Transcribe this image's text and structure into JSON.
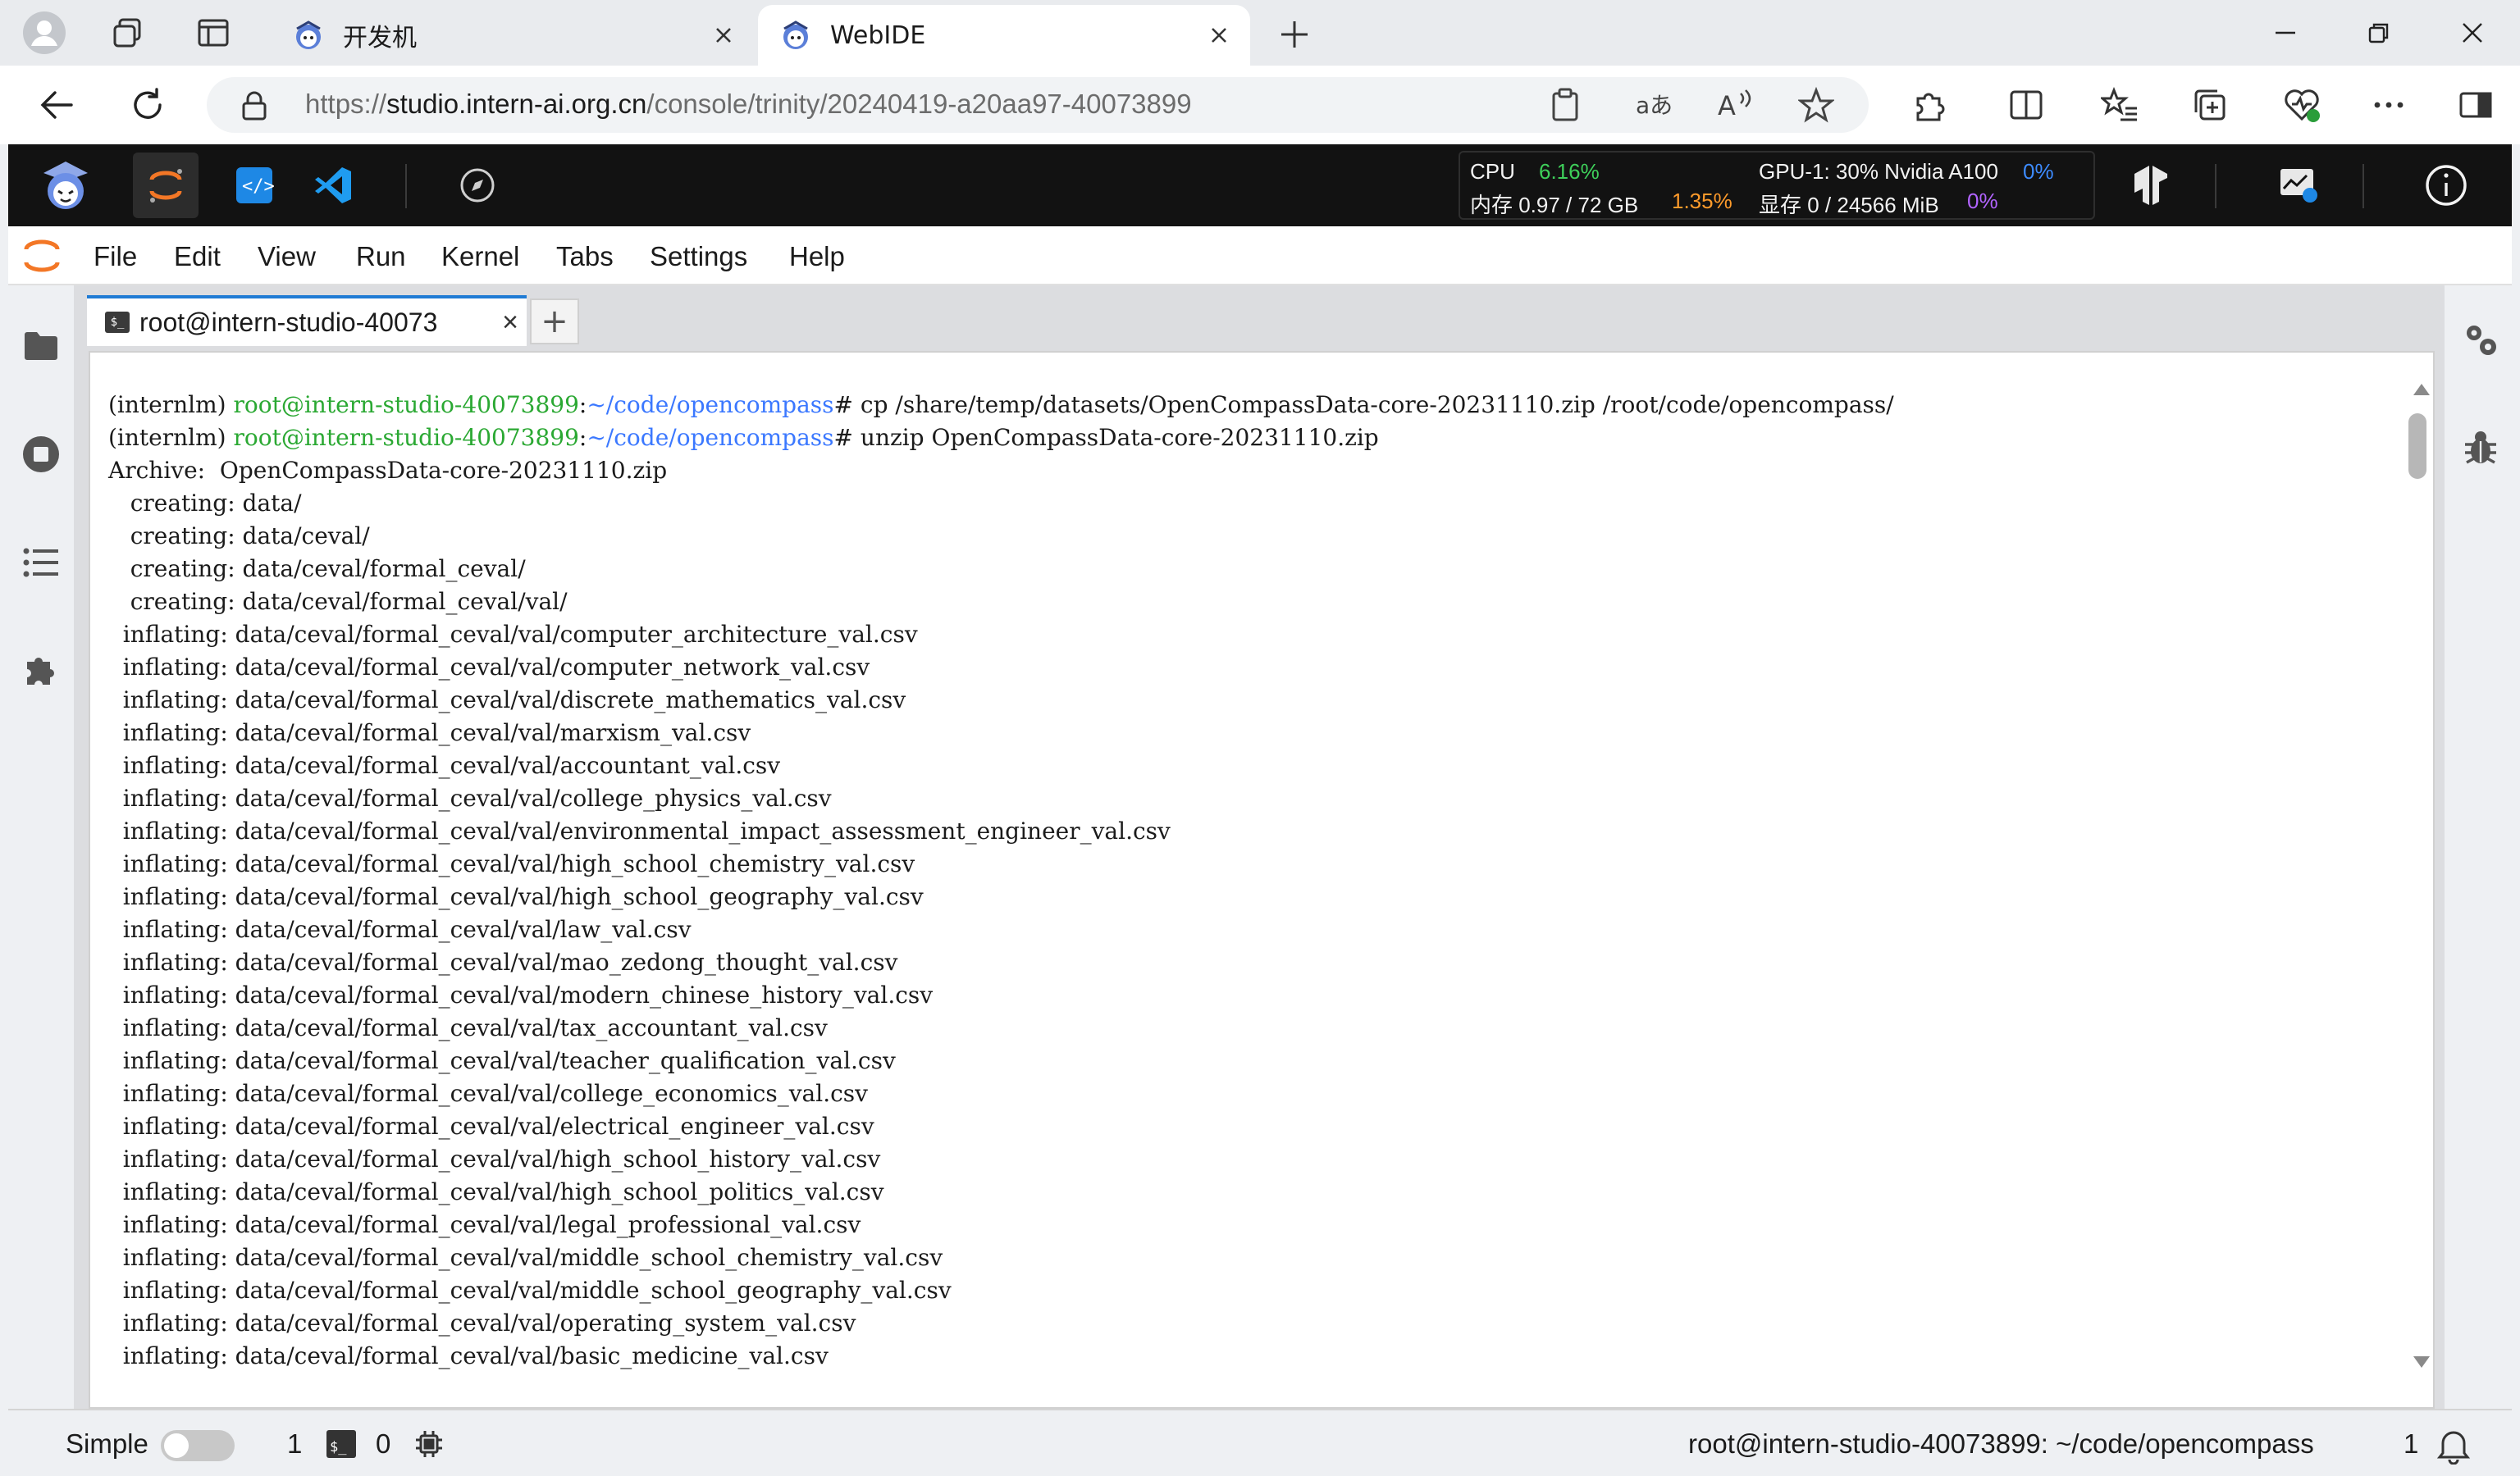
{
  "browser": {
    "tabs": [
      {
        "title": "开发机"
      },
      {
        "title": "WebIDE"
      }
    ],
    "url": {
      "scheme": "https://",
      "host": "studio.intern-ai.org.cn",
      "path": "/console/trinity/20240419-a20aa97-40073899"
    }
  },
  "studio": {
    "monitor": {
      "cpu_label": "CPU",
      "cpu_value": "6.16%",
      "mem_label": "内存 0.97 / 72 GB",
      "mem_value": "1.35%",
      "gpu_label": "GPU-1: 30% Nvidia A100",
      "gpu_value": "0%",
      "vram_label": "显存 0 / 24566 MiB",
      "vram_value": "0%"
    }
  },
  "menu": [
    "File",
    "Edit",
    "View",
    "Run",
    "Kernel",
    "Tabs",
    "Settings",
    "Help"
  ],
  "terminal": {
    "tab_title": "root@intern-studio-40073",
    "tab_icon_text": "$_",
    "prompts": [
      {
        "env": "(internlm) ",
        "user": "root@intern-studio-40073899",
        "sep": ":",
        "path": "~/code/opencompass",
        "cmd": "# cp /share/temp/datasets/OpenCompassData-core-20231110.zip /root/code/opencompass/"
      },
      {
        "env": "(internlm) ",
        "user": "root@intern-studio-40073899",
        "sep": ":",
        "path": "~/code/opencompass",
        "cmd": "# unzip OpenCompassData-core-20231110.zip"
      }
    ],
    "output": [
      "Archive:  OpenCompassData-core-20231110.zip",
      "   creating: data/",
      "   creating: data/ceval/",
      "   creating: data/ceval/formal_ceval/",
      "   creating: data/ceval/formal_ceval/val/",
      "  inflating: data/ceval/formal_ceval/val/computer_architecture_val.csv",
      "  inflating: data/ceval/formal_ceval/val/computer_network_val.csv",
      "  inflating: data/ceval/formal_ceval/val/discrete_mathematics_val.csv",
      "  inflating: data/ceval/formal_ceval/val/marxism_val.csv",
      "  inflating: data/ceval/formal_ceval/val/accountant_val.csv",
      "  inflating: data/ceval/formal_ceval/val/college_physics_val.csv",
      "  inflating: data/ceval/formal_ceval/val/environmental_impact_assessment_engineer_val.csv",
      "  inflating: data/ceval/formal_ceval/val/high_school_chemistry_val.csv",
      "  inflating: data/ceval/formal_ceval/val/high_school_geography_val.csv",
      "  inflating: data/ceval/formal_ceval/val/law_val.csv",
      "  inflating: data/ceval/formal_ceval/val/mao_zedong_thought_val.csv",
      "  inflating: data/ceval/formal_ceval/val/modern_chinese_history_val.csv",
      "  inflating: data/ceval/formal_ceval/val/tax_accountant_val.csv",
      "  inflating: data/ceval/formal_ceval/val/teacher_qualification_val.csv",
      "  inflating: data/ceval/formal_ceval/val/college_economics_val.csv",
      "  inflating: data/ceval/formal_ceval/val/electrical_engineer_val.csv",
      "  inflating: data/ceval/formal_ceval/val/high_school_history_val.csv",
      "  inflating: data/ceval/formal_ceval/val/high_school_politics_val.csv",
      "  inflating: data/ceval/formal_ceval/val/legal_professional_val.csv",
      "  inflating: data/ceval/formal_ceval/val/middle_school_chemistry_val.csv",
      "  inflating: data/ceval/formal_ceval/val/middle_school_geography_val.csv",
      "  inflating: data/ceval/formal_ceval/val/operating_system_val.csv",
      "  inflating: data/ceval/formal_ceval/val/basic_medicine_val.csv"
    ]
  },
  "statusbar": {
    "mode_label": "Simple",
    "kernel_count": "1",
    "terminal_count": "0",
    "location": "root@intern-studio-40073899: ~/code/opencompass",
    "notification_count": "1"
  }
}
